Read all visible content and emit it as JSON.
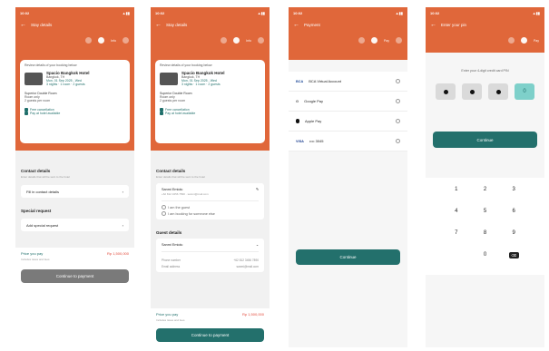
{
  "screen1": {
    "status": {
      "time": "10:02",
      "icons": "▲▮▮"
    },
    "title": "Stay details",
    "steps": [
      "",
      "Info",
      ""
    ],
    "card": {
      "note": "Review details of your booking below",
      "hotel_name": "Spacio Bangkok Hotel",
      "hotel_sub": "Bangkok, TH",
      "check": "Mon, 01 Sep 2025 - Wed",
      "check2": "3 nights · 1 room · 2 guests",
      "room_title": "Superior Double Room",
      "room_sub": "Room only",
      "room_sub2": "2 guests per room",
      "opt1": "Free cancellation",
      "opt2": "Pay at hotel available"
    },
    "contact_label": "Contact details",
    "contact_sub": "Enter details that will be sent to the hotel",
    "contact_select": "Fill in contact details",
    "special_label": "Special request",
    "special_select": "Add special request",
    "price_label": "Price you pay",
    "price_value": "Rp 1,500,000",
    "price_note": "Includes taxes and fees",
    "button": "Continue to payment"
  },
  "screen2": {
    "status": {
      "time": "10:02",
      "icons": "▲▮▮"
    },
    "title": "Stay details",
    "steps": [
      "",
      "Info",
      ""
    ],
    "card": {
      "note": "Review details of your booking below",
      "hotel_name": "Spacio Bangkok Hotel",
      "hotel_sub": "Bangkok, TH",
      "check": "Mon, 01 Sep 2025 - Wed",
      "check2": "3 nights · 1 room · 2 guests",
      "room_title": "Superior Double Room",
      "room_sub": "Room only",
      "room_sub2": "2 guests per room",
      "opt1": "Free cancellation",
      "opt2": "Pay at hotel available"
    },
    "contact_label": "Contact details",
    "contact_sub": "Enter details that will be sent to the hotel",
    "contact_name": "Sanmi Emiolu",
    "contact_info": "+62 812 3456 7890 · sanmi@mail.com",
    "guest_opt1": "I am the guest",
    "guest_opt2": "I am booking for someone else",
    "guest_label": "Guest details",
    "guest_name": "Sanmi Emiolu",
    "g_row1_label": "Phone number",
    "g_row1_value": "+62 812 3456 7890",
    "g_row2_label": "Email address",
    "g_row2_value": "sanmi@mail.com",
    "price_label": "Price you pay",
    "price_value": "Rp 1,500,000",
    "price_note": "Includes taxes and fees",
    "button": "Continue to payment"
  },
  "screen3": {
    "status": {
      "time": "10:02",
      "icons": "▲▮▮"
    },
    "title": "Payment",
    "steps": [
      "",
      "Pay",
      ""
    ],
    "methods": [
      {
        "icon": "BCA",
        "label": "BCA Virtual Account"
      },
      {
        "icon": "G",
        "label": "Google Pay"
      },
      {
        "icon": "",
        "label": "Apple Pay"
      },
      {
        "icon": "VISA",
        "label": "•••• 3045"
      }
    ],
    "button": "Continue"
  },
  "screen4": {
    "status": {
      "time": "10:02",
      "icons": "▲▮▮"
    },
    "title": "Enter your pin",
    "steps": [
      "",
      "",
      "Pay"
    ],
    "prompt": "Enter your 4-digit credit card PIN",
    "button": "Continue",
    "keys": [
      "1",
      "2",
      "3",
      "4",
      "5",
      "6",
      "7",
      "8",
      "9",
      "",
      "0",
      "⌫"
    ]
  },
  "colors": {
    "brand": "#e0673a",
    "accent": "#23706c",
    "price": "#e24a3b"
  }
}
